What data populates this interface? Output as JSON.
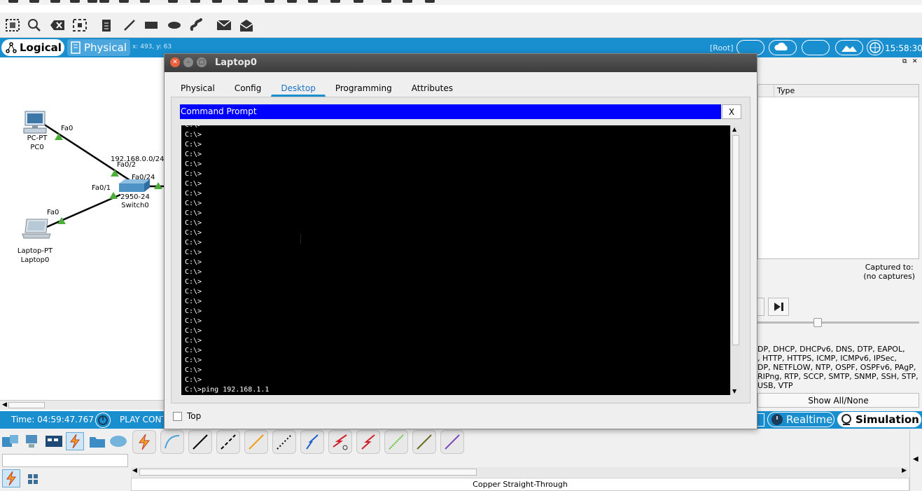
{
  "main_tabs": {
    "logical": "Logical",
    "physical": "Physical",
    "coords": "x: 493, y: 63"
  },
  "workspace": {
    "root_label": "[Root]",
    "clock": "15:58:30"
  },
  "devices": [
    {
      "model": "PC-PT",
      "name": "PC0"
    },
    {
      "model": "2950-24",
      "name": "Switch0"
    },
    {
      "model": "Laptop-PT",
      "name": "Laptop0"
    }
  ],
  "interfaces": {
    "pc_fa0": "Fa0",
    "sw_fa02": "Fa0/2",
    "sw_fa024": "Fa0/24",
    "sw_fa01": "Fa0/1",
    "lap_fa0": "Fa0",
    "network_label": "192.168.0.0/24"
  },
  "right_panel": {
    "type_header": "Type",
    "captured_to": "Captured to:",
    "no_captures": "(no captures)",
    "protocols": [
      "DP, DHCP, DHCPv6, DNS, DTP, EAPOL,",
      ", HTTP, HTTPS, ICMP, ICMPv6, IPSec,",
      "DP, NETFLOW, NTP, OSPF, OSPFv6, PAgP,",
      "RIPng, RTP, SCCP, SMTP, SNMP, SSH, STP,",
      "USB, VTP"
    ],
    "show_all": "Show All/None",
    "play_icon": "step-forward-icon"
  },
  "time_bar": {
    "time": "Time: 04:59:47.767",
    "play": "PLAY CONTROLS",
    "realtime": "Realtime",
    "simulation": "Simulation"
  },
  "status": {
    "cable_name": "Copper Straight-Through"
  },
  "dialog": {
    "title": "Laptop0",
    "tabs": [
      "Physical",
      "Config",
      "Desktop",
      "Programming",
      "Attributes"
    ],
    "active_tab": "Desktop",
    "app_title": "Command Prompt",
    "close_label": "X",
    "top_label": "Top",
    "terminal": {
      "lines": [
        "C:\\>",
        "C:\\>",
        "C:\\>",
        "C:\\>",
        "C:\\>",
        "C:\\>",
        "C:\\>",
        "C:\\>",
        "C:\\>",
        "C:\\>",
        "C:\\>",
        "C:\\>",
        "C:\\>",
        "C:\\>",
        "C:\\>",
        "C:\\>",
        "C:\\>",
        "C:\\>",
        "C:\\>",
        "C:\\>",
        "C:\\>",
        "C:\\>",
        "C:\\>",
        "C:\\>",
        "C:\\>",
        "C:\\>",
        "C:\\>",
        "C:\\>ping 192.168.1.1"
      ]
    }
  },
  "colors": {
    "accent": "#1a8fd0",
    "title_bar": "#0000ff",
    "terminal_bg": "#000000",
    "link_green": "#4caf3a"
  }
}
